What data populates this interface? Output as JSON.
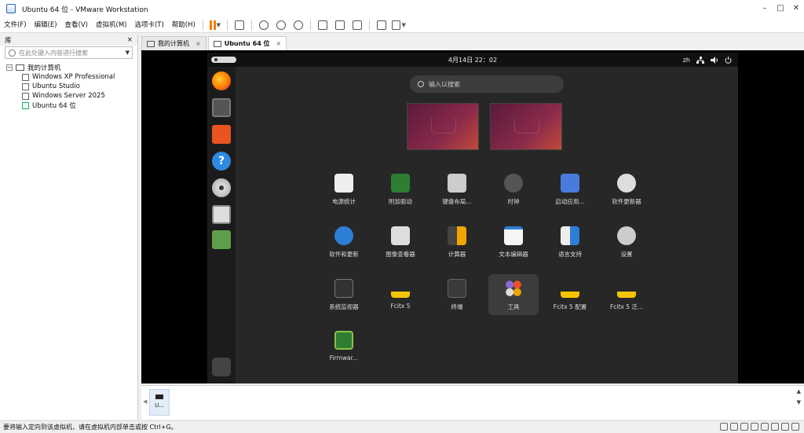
{
  "window": {
    "title": "Ubuntu 64 位 - VMware Workstation",
    "min": "–",
    "max": "□",
    "close": "✕"
  },
  "menu": {
    "items": [
      "文件(F)",
      "编辑(E)",
      "查看(V)",
      "虚拟机(M)",
      "选项卡(T)",
      "帮助(H)"
    ]
  },
  "library": {
    "title": "库",
    "close": "×",
    "search_placeholder": "在此处键入内容进行搜索",
    "root": "我的计算机",
    "vms": [
      "Windows XP Professional",
      "Ubuntu Studio",
      "Windows Server 2025",
      "Ubuntu 64 位"
    ]
  },
  "tabs": [
    {
      "label": "我的计算机",
      "close": "×"
    },
    {
      "label": "Ubuntu 64 位",
      "close": "×"
    }
  ],
  "guest": {
    "clock": "4月14日  22：02",
    "lang": "zh",
    "search_placeholder": "输入以搜索",
    "apps": [
      {
        "label": "电源统计",
        "icon": "power-statistics-icon"
      },
      {
        "label": "附加驱动",
        "icon": "additional-drivers-icon"
      },
      {
        "label": "键盘布局...",
        "icon": "keyboard-icon"
      },
      {
        "label": "时钟",
        "icon": "clock-icon"
      },
      {
        "label": "启动应用...",
        "icon": "startup-apps-icon"
      },
      {
        "label": "软件更新器",
        "icon": "software-updater-icon"
      },
      {
        "label": "软件和更新",
        "icon": "software-updates-icon"
      },
      {
        "label": "图像查看器",
        "icon": "image-viewer-icon"
      },
      {
        "label": "计算器",
        "icon": "calculator-icon"
      },
      {
        "label": "文本编辑器",
        "icon": "text-editor-icon"
      },
      {
        "label": "语言支持",
        "icon": "language-support-icon"
      },
      {
        "label": "设置",
        "icon": "settings-icon"
      },
      {
        "label": "系统监视器",
        "icon": "system-monitor-icon"
      },
      {
        "label": "Fcitx 5",
        "icon": "fcitx-icon"
      },
      {
        "label": "终端",
        "icon": "terminal-icon"
      },
      {
        "label": "工具",
        "icon": "utilities-folder-icon"
      },
      {
        "label": "Fcitx 5 配置",
        "icon": "fcitx-config-icon"
      },
      {
        "label": "Fcitx 5 迁...",
        "icon": "fcitx-migrator-icon"
      },
      {
        "label": "Firmwar...",
        "icon": "firmware-icon"
      }
    ]
  },
  "thumbnail": {
    "label": "U..."
  },
  "status": {
    "text": "要将输入定向到该虚拟机，请在虚拟机内部单击或按 Ctrl+G。"
  },
  "colors": {
    "accent": "#f07c00",
    "ubuntu_bg": "#272727",
    "dock": "#1c1c1c"
  }
}
